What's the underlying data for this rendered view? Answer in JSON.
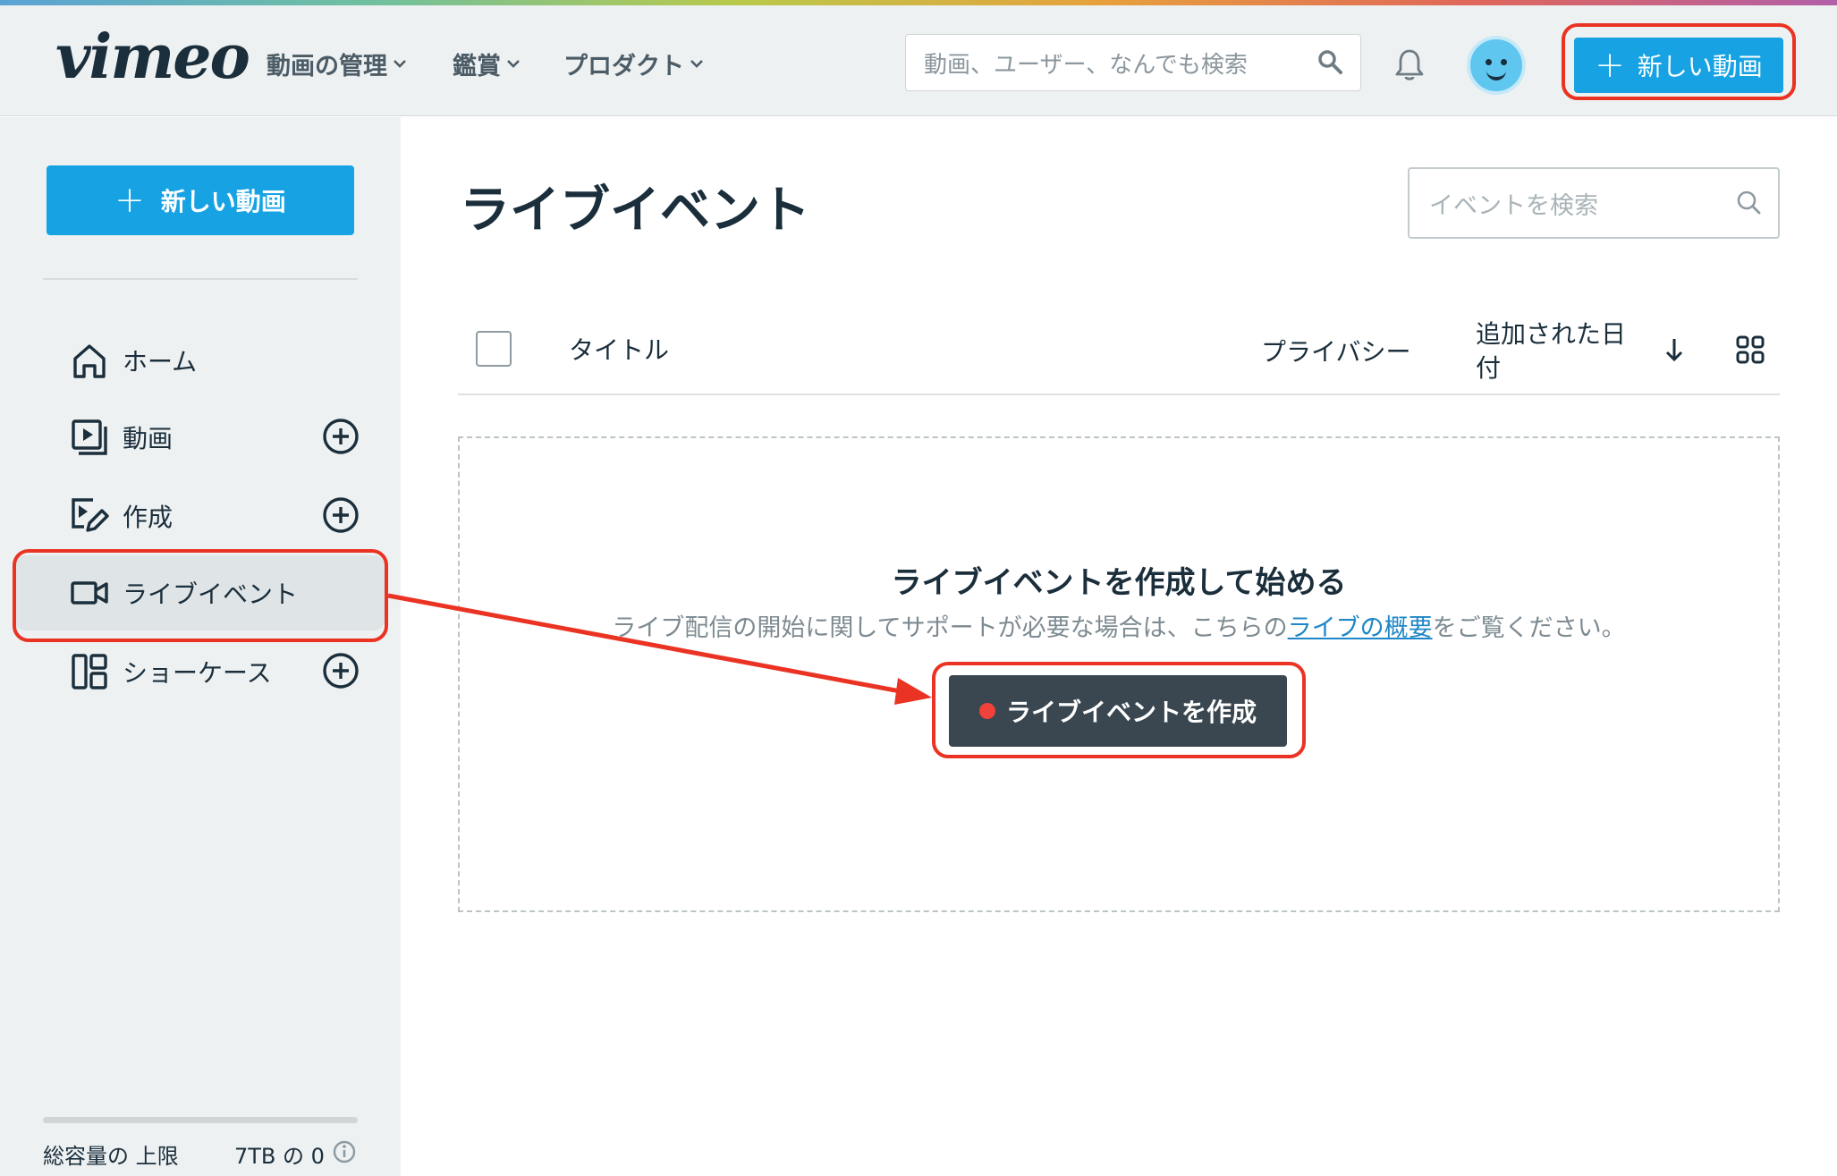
{
  "header": {
    "logo": "vimeo",
    "nav": [
      {
        "label": "動画の管理"
      },
      {
        "label": "鑑賞"
      },
      {
        "label": "プロダクト"
      }
    ],
    "search_placeholder": "動画、ユーザー、なんでも検索",
    "new_video_label": "新しい動画"
  },
  "sidebar": {
    "new_video_label": "新しい動画",
    "items": [
      {
        "label": "ホーム",
        "icon": "home-icon"
      },
      {
        "label": "動画",
        "icon": "video-library-icon"
      },
      {
        "label": "作成",
        "icon": "create-icon"
      },
      {
        "label": "ライブイベント",
        "icon": "camera-icon"
      },
      {
        "label": "ショーケース",
        "icon": "showcase-icon"
      }
    ],
    "storage_left": "総容量の 上限",
    "storage_right": "7TB の 0"
  },
  "main": {
    "title": "ライブイベント",
    "search_placeholder": "イベントを検索",
    "columns": {
      "title": "タイトル",
      "privacy": "プライバシー",
      "date_added_line1": "追加された日",
      "date_added_line2": "付"
    },
    "empty": {
      "heading": "ライブイベントを作成して始める",
      "sub_before": "ライブ配信の開始に関してサポートが必要な場合は、こちらの",
      "sub_link": "ライブの概要",
      "sub_after": "をご覧ください。",
      "create_label": "ライブイベントを作成"
    }
  },
  "colors": {
    "accent": "#17a3e3",
    "highlight": "#ea3323",
    "dark_button": "#3a4750"
  }
}
